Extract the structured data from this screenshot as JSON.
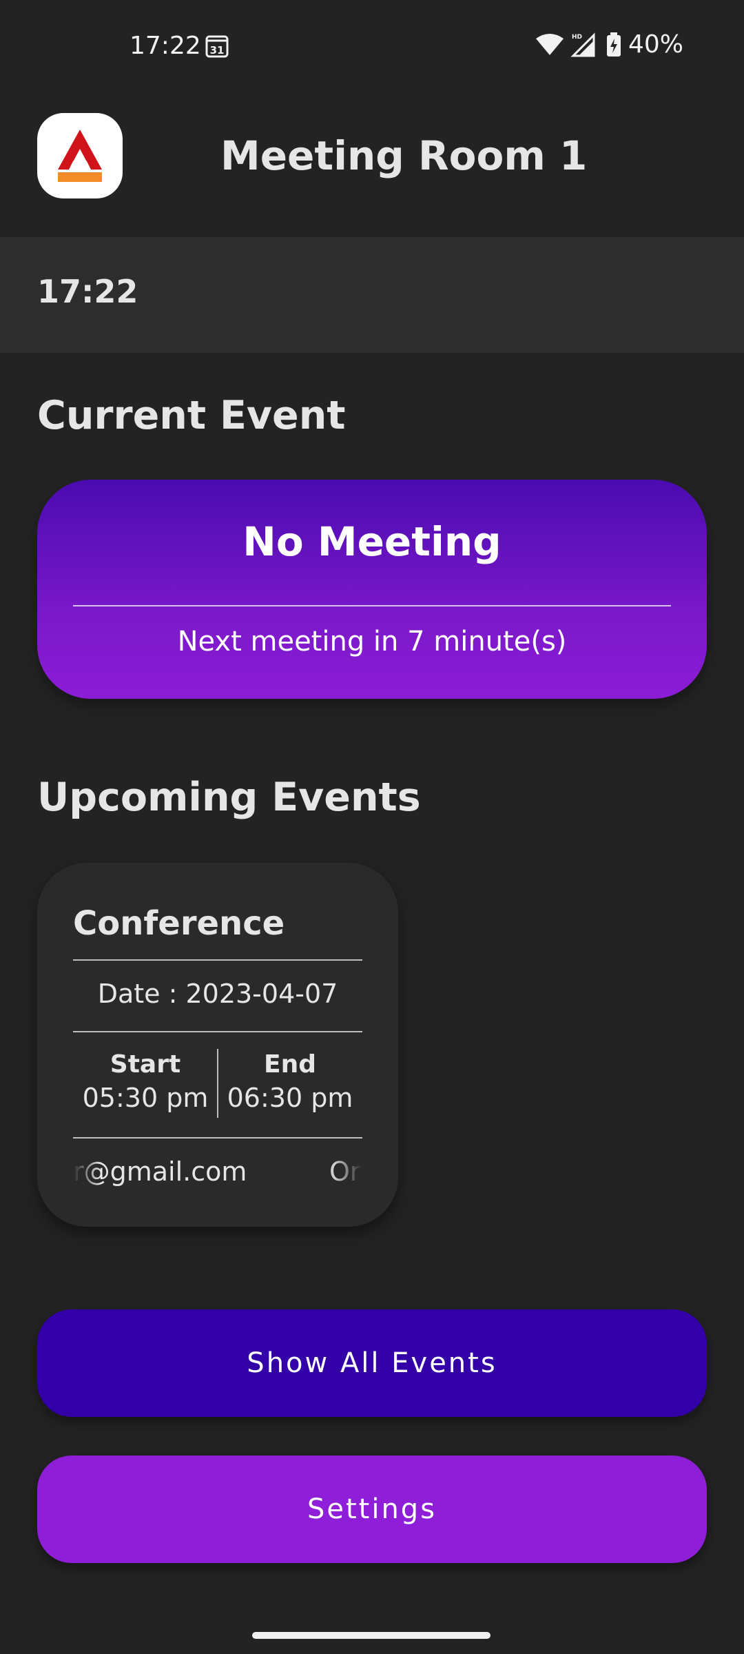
{
  "status_bar": {
    "time": "17:22",
    "calendar_day": "31",
    "hd_label": "HD",
    "battery": "40%"
  },
  "app_bar": {
    "title": "Meeting Room 1",
    "logo_colors": {
      "red": "#d0141a",
      "orange": "#f28c28"
    }
  },
  "clock": {
    "time": "17:22"
  },
  "current_event": {
    "section_title": "Current Event",
    "title": "No Meeting",
    "subtitle": "Next meeting in 7 minute(s)"
  },
  "upcoming_events": {
    "section_title": "Upcoming Events",
    "events": [
      {
        "name": "Conference",
        "date": "Date : 2023-04-07",
        "start_label": "Start",
        "start_time": "05:30 pm",
        "end_label": "End",
        "end_time": "06:30 pm",
        "organizer_email": "r@gmail.com",
        "organizer_label": "Or"
      }
    ]
  },
  "buttons": {
    "show_all_events": "Show All Events",
    "settings": "Settings"
  },
  "colors": {
    "background": "#232323",
    "clock_bar": "#2d2d2d",
    "primary_dark": "#3300a8",
    "primary_light": "#8e1ed8"
  }
}
